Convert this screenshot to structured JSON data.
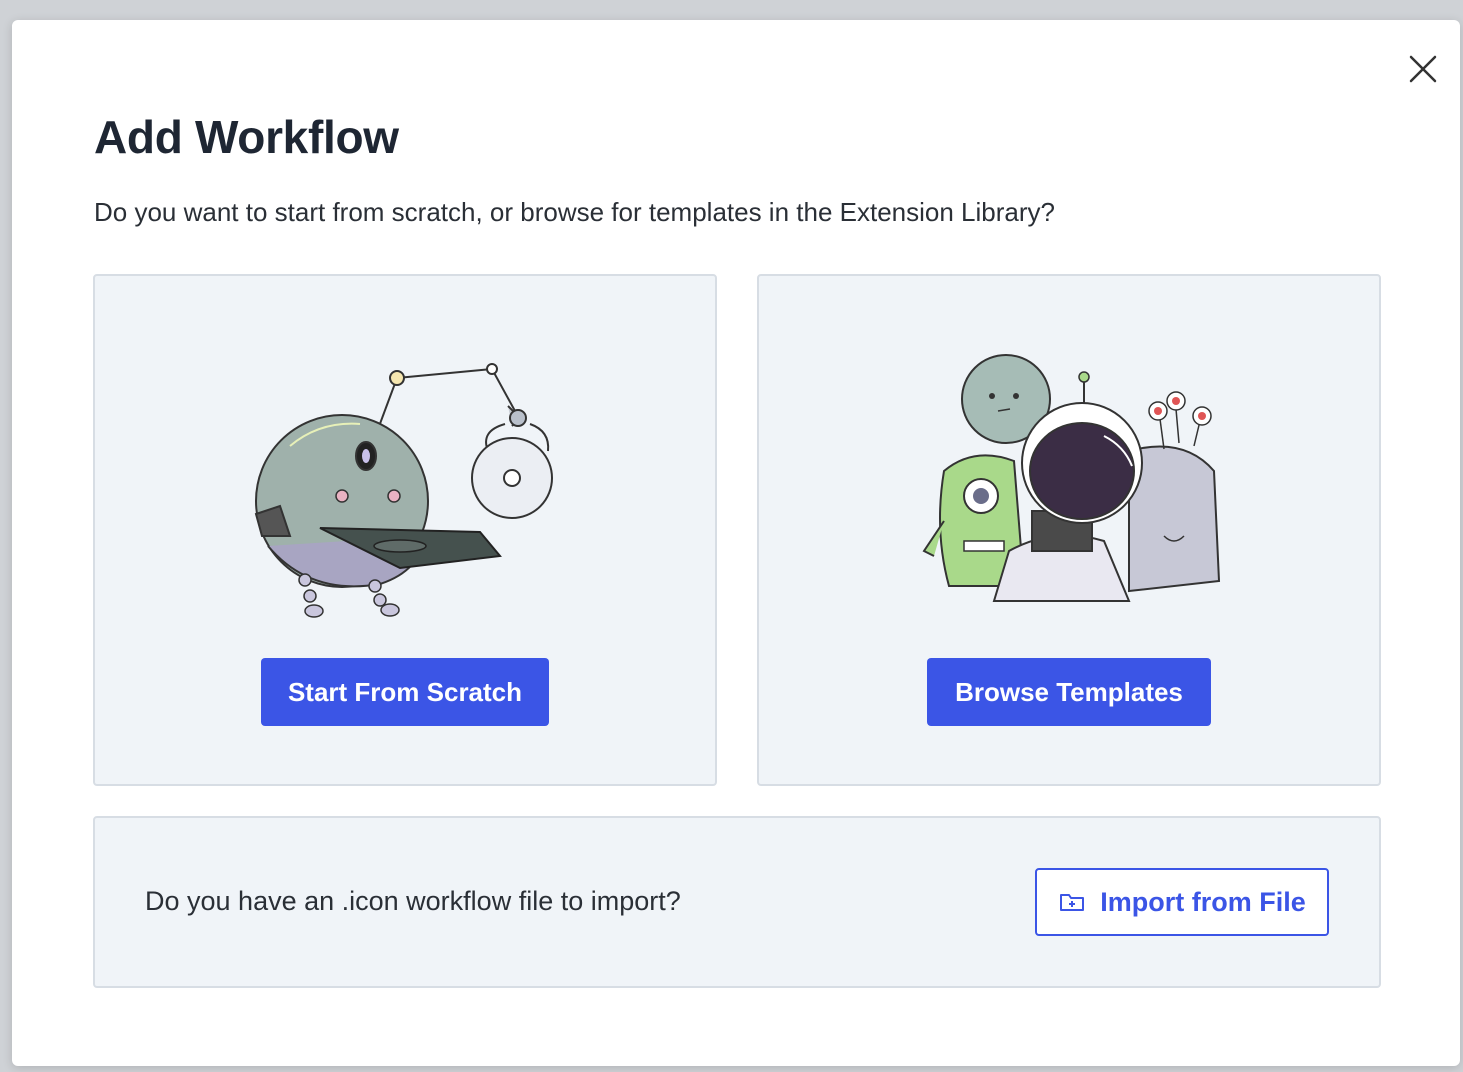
{
  "dialog": {
    "title": "Add Workflow",
    "subtitle": "Do you want to start from scratch, or browse for templates in the Extension Library?"
  },
  "cards": {
    "scratch": {
      "button_label": "Start From Scratch",
      "illustration": "robot-arm-illustration"
    },
    "templates": {
      "button_label": "Browse Templates",
      "illustration": "characters-group-illustration"
    }
  },
  "import": {
    "prompt": "Do you have an .icon workflow file to import?",
    "button_label": "Import from File",
    "button_icon": "folder-plus-icon"
  },
  "colors": {
    "primary": "#3b55e6",
    "card_bg": "#f0f4f8",
    "title": "#1e2633"
  }
}
